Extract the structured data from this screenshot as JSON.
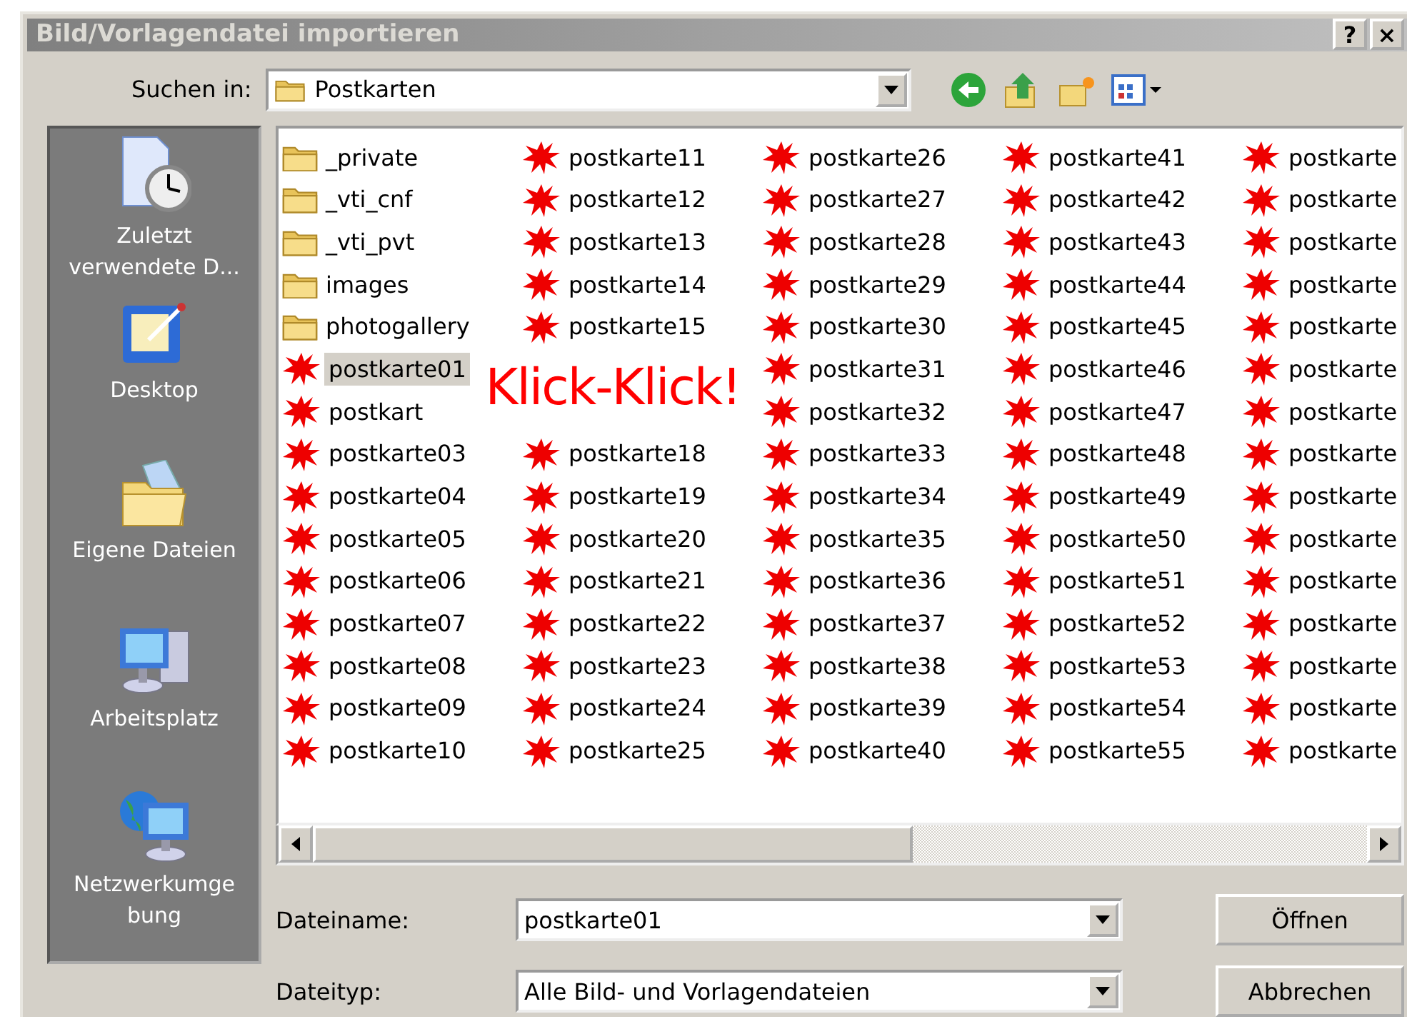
{
  "window": {
    "title": "Bild/Vorlagendatei importieren",
    "buttons": [
      "?",
      "×"
    ]
  },
  "look_in": {
    "label": "Suchen in:",
    "value": "Postkarten"
  },
  "places": [
    {
      "kind": "recent",
      "label": "Zuletzt\nverwendete D..."
    },
    {
      "kind": "desktop",
      "label": "Desktop"
    },
    {
      "kind": "documents",
      "label": "Eigene Dateien"
    },
    {
      "kind": "computer",
      "label": "Arbeitsplatz"
    },
    {
      "kind": "network",
      "label": "Netzwerkumge\nbung"
    }
  ],
  "file_list": {
    "overlay_text": "Klick-Klick!",
    "items": [
      {
        "kind": "folder",
        "name": "_private",
        "selected": false
      },
      {
        "kind": "folder",
        "name": "_vti_cnf",
        "selected": false
      },
      {
        "kind": "folder",
        "name": "_vti_pvt",
        "selected": false
      },
      {
        "kind": "folder",
        "name": "images",
        "selected": false
      },
      {
        "kind": "folder",
        "name": "photogallery",
        "selected": false
      },
      {
        "kind": "image",
        "name": "postkarte01",
        "selected": true
      },
      {
        "kind": "image",
        "name": "postkart",
        "selected": false
      },
      {
        "kind": "image",
        "name": "postkarte03",
        "selected": false
      },
      {
        "kind": "image",
        "name": "postkarte04",
        "selected": false
      },
      {
        "kind": "image",
        "name": "postkarte05",
        "selected": false
      },
      {
        "kind": "image",
        "name": "postkarte06",
        "selected": false
      },
      {
        "kind": "image",
        "name": "postkarte07",
        "selected": false
      },
      {
        "kind": "image",
        "name": "postkarte08",
        "selected": false
      },
      {
        "kind": "image",
        "name": "postkarte09",
        "selected": false
      },
      {
        "kind": "image",
        "name": "postkarte10",
        "selected": false
      },
      {
        "kind": "image",
        "name": "postkarte11",
        "selected": false
      },
      {
        "kind": "image",
        "name": "postkarte12",
        "selected": false
      },
      {
        "kind": "image",
        "name": "postkarte13",
        "selected": false
      },
      {
        "kind": "image",
        "name": "postkarte14",
        "selected": false
      },
      {
        "kind": "image",
        "name": "postkarte15",
        "selected": false
      },
      {
        "kind": "hidden"
      },
      {
        "kind": "hidden"
      },
      {
        "kind": "image",
        "name": "postkarte18",
        "selected": false
      },
      {
        "kind": "image",
        "name": "postkarte19",
        "selected": false
      },
      {
        "kind": "image",
        "name": "postkarte20",
        "selected": false
      },
      {
        "kind": "image",
        "name": "postkarte21",
        "selected": false
      },
      {
        "kind": "image",
        "name": "postkarte22",
        "selected": false
      },
      {
        "kind": "image",
        "name": "postkarte23",
        "selected": false
      },
      {
        "kind": "image",
        "name": "postkarte24",
        "selected": false
      },
      {
        "kind": "image",
        "name": "postkarte25",
        "selected": false
      },
      {
        "kind": "image",
        "name": "postkarte26",
        "selected": false
      },
      {
        "kind": "image",
        "name": "postkarte27",
        "selected": false
      },
      {
        "kind": "image",
        "name": "postkarte28",
        "selected": false
      },
      {
        "kind": "image",
        "name": "postkarte29",
        "selected": false
      },
      {
        "kind": "image",
        "name": "postkarte30",
        "selected": false
      },
      {
        "kind": "image",
        "name": "postkarte31",
        "selected": false
      },
      {
        "kind": "image",
        "name": "postkarte32",
        "selected": false
      },
      {
        "kind": "image",
        "name": "postkarte33",
        "selected": false
      },
      {
        "kind": "image",
        "name": "postkarte34",
        "selected": false
      },
      {
        "kind": "image",
        "name": "postkarte35",
        "selected": false
      },
      {
        "kind": "image",
        "name": "postkarte36",
        "selected": false
      },
      {
        "kind": "image",
        "name": "postkarte37",
        "selected": false
      },
      {
        "kind": "image",
        "name": "postkarte38",
        "selected": false
      },
      {
        "kind": "image",
        "name": "postkarte39",
        "selected": false
      },
      {
        "kind": "image",
        "name": "postkarte40",
        "selected": false
      },
      {
        "kind": "image",
        "name": "postkarte41",
        "selected": false
      },
      {
        "kind": "image",
        "name": "postkarte42",
        "selected": false
      },
      {
        "kind": "image",
        "name": "postkarte43",
        "selected": false
      },
      {
        "kind": "image",
        "name": "postkarte44",
        "selected": false
      },
      {
        "kind": "image",
        "name": "postkarte45",
        "selected": false
      },
      {
        "kind": "image",
        "name": "postkarte46",
        "selected": false
      },
      {
        "kind": "image",
        "name": "postkarte47",
        "selected": false
      },
      {
        "kind": "image",
        "name": "postkarte48",
        "selected": false
      },
      {
        "kind": "image",
        "name": "postkarte49",
        "selected": false
      },
      {
        "kind": "image",
        "name": "postkarte50",
        "selected": false
      },
      {
        "kind": "image",
        "name": "postkarte51",
        "selected": false
      },
      {
        "kind": "image",
        "name": "postkarte52",
        "selected": false
      },
      {
        "kind": "image",
        "name": "postkarte53",
        "selected": false
      },
      {
        "kind": "image",
        "name": "postkarte54",
        "selected": false
      },
      {
        "kind": "image",
        "name": "postkarte55",
        "selected": false
      },
      {
        "kind": "image",
        "name": "postkarte",
        "selected": false
      },
      {
        "kind": "image",
        "name": "postkarte",
        "selected": false
      },
      {
        "kind": "image",
        "name": "postkarte",
        "selected": false
      },
      {
        "kind": "image",
        "name": "postkarte",
        "selected": false
      },
      {
        "kind": "image",
        "name": "postkarte",
        "selected": false
      },
      {
        "kind": "image",
        "name": "postkarte",
        "selected": false
      },
      {
        "kind": "image",
        "name": "postkarte",
        "selected": false
      },
      {
        "kind": "image",
        "name": "postkarte",
        "selected": false
      },
      {
        "kind": "image",
        "name": "postkarte",
        "selected": false
      },
      {
        "kind": "image",
        "name": "postkarte",
        "selected": false
      },
      {
        "kind": "image",
        "name": "postkarte",
        "selected": false
      },
      {
        "kind": "image",
        "name": "postkarte",
        "selected": false
      },
      {
        "kind": "image",
        "name": "postkarte",
        "selected": false
      },
      {
        "kind": "image",
        "name": "postkarte",
        "selected": false
      },
      {
        "kind": "image",
        "name": "postkarte",
        "selected": false
      }
    ]
  },
  "file_name": {
    "label": "Dateiname:",
    "value": "postkarte01"
  },
  "file_type": {
    "label": "Dateityp:",
    "value": "Alle Bild- und Vorlagendateien"
  },
  "buttons": [
    "Öffnen",
    "Abbrechen"
  ]
}
